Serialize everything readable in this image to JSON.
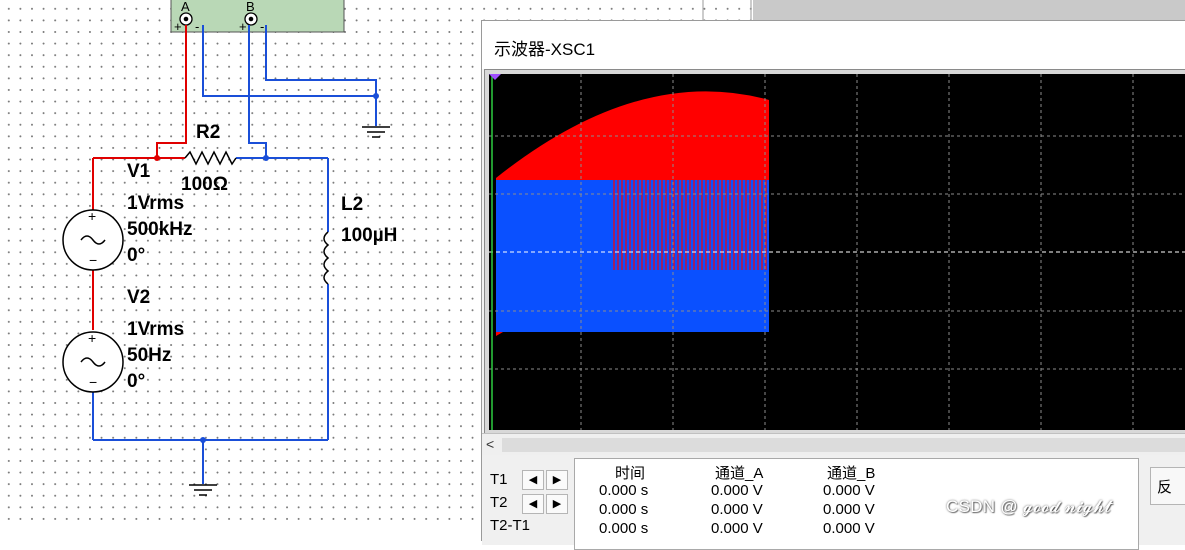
{
  "schematic": {
    "probe_labels": {
      "a": "A",
      "b": "B"
    },
    "r2": {
      "name": "R2",
      "value": "100Ω"
    },
    "l2": {
      "name": "L2",
      "value": "100µH"
    },
    "v1": {
      "name": "V1",
      "amplitude": "1Vrms",
      "freq": "500kHz",
      "phase": "0°"
    },
    "v2": {
      "name": "V2",
      "amplitude": "1Vrms",
      "freq": "50Hz",
      "phase": "0°"
    },
    "colors": {
      "wire_red": "#e00000",
      "wire_blue": "#1a4fd8",
      "instrument": "#b9d8b6"
    }
  },
  "oscilloscope": {
    "title": "示波器-XSC1",
    "scroll_left": "<",
    "cursor_rows": [
      "T1",
      "T2",
      "T2-T1"
    ],
    "headers": {
      "time": "时间",
      "ch_a": "通道_A",
      "ch_b": "通道_B"
    },
    "rows": [
      {
        "time": "0.000 s",
        "a": "0.000 V",
        "b": "0.000 V"
      },
      {
        "time": "0.000 s",
        "a": "0.000 V",
        "b": "0.000 V"
      },
      {
        "time": "0.000 s",
        "a": "0.000 V",
        "b": "0.000 V"
      }
    ],
    "side_button": "反",
    "colors": {
      "channel_a": "#ff0000",
      "channel_b": "#0a50ff",
      "screen_bg": "#000000"
    }
  },
  "watermark": "CSDN @ 𝓰𝓸𝓸𝓭 𝓷𝓲𝓰𝓱𝓽"
}
